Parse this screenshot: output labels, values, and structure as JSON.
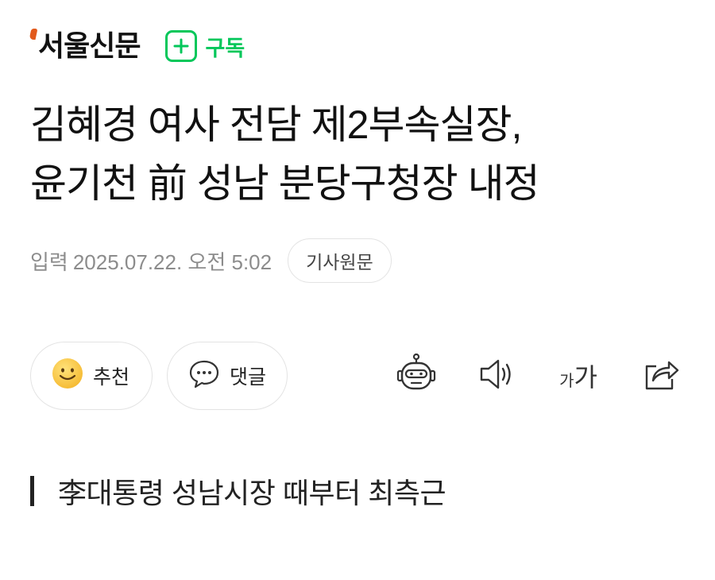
{
  "press": {
    "name": "서울신문",
    "subscribe_label": "구독",
    "accent_color": "#03c75a",
    "logo_mark_color": "#e25a1c"
  },
  "article": {
    "title_line1": "김혜경 여사 전담 제2부속실장,",
    "title_line2": "윤기천 前 성남 분당구청장 내정",
    "date_label": "입력",
    "date_value": "2025.07.22. 오전 5:02",
    "origin_label": "기사원문",
    "subtitle": "李대통령 성남시장 때부터 최측근"
  },
  "actions": {
    "recommend_label": "추천",
    "comment_label": "댓글",
    "font_small": "가",
    "font_large": "가",
    "icons": [
      "smiley-icon",
      "speech-bubble-icon",
      "robot-icon",
      "speaker-icon",
      "font-size-icon",
      "share-icon"
    ]
  }
}
